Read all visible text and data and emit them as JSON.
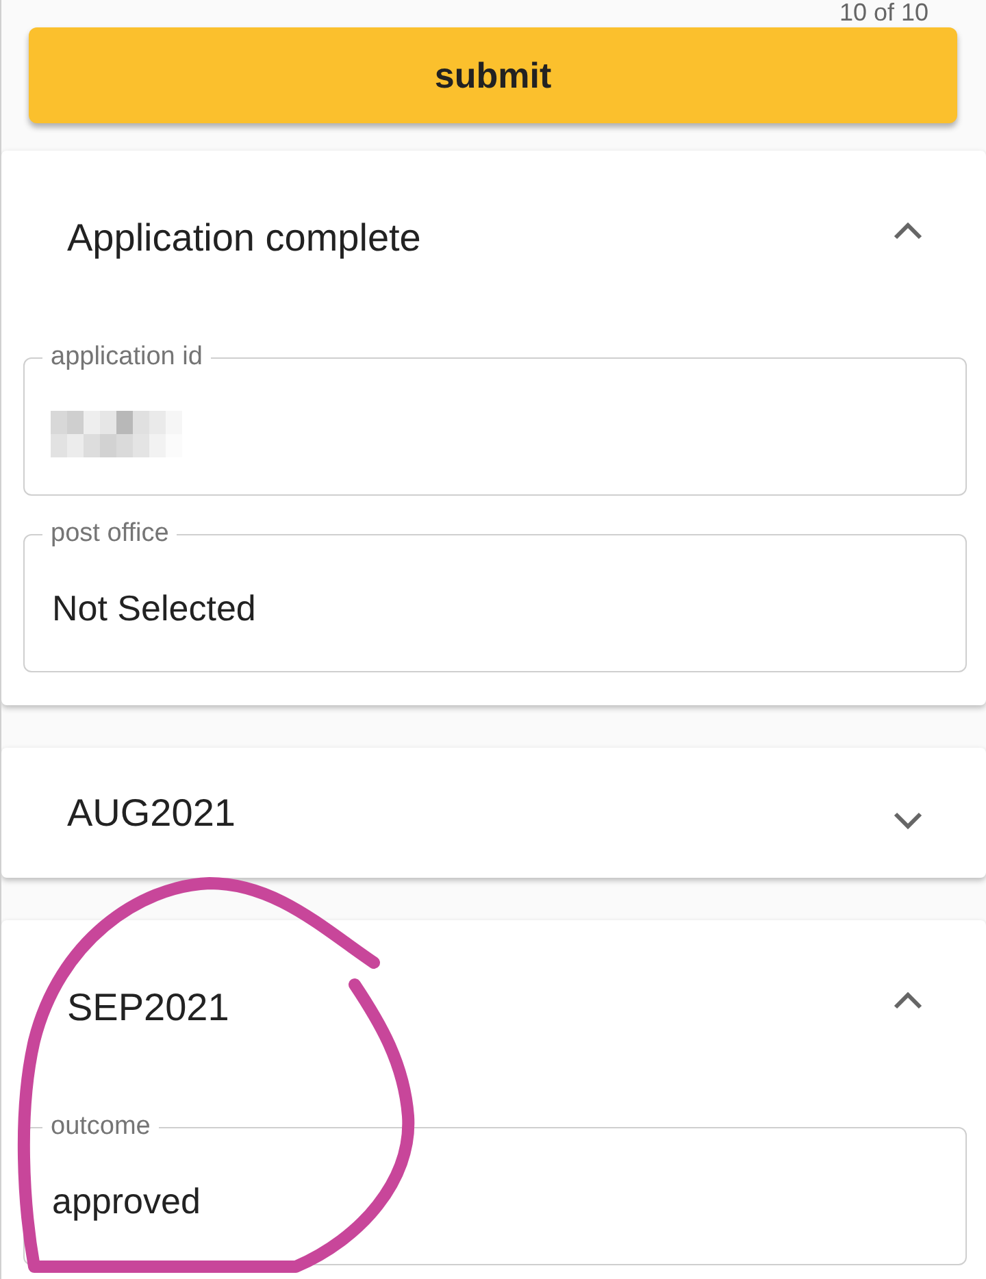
{
  "pager": {
    "text": "10 of 10"
  },
  "submit_button": {
    "label": "submit"
  },
  "panels": [
    {
      "title": "Application complete",
      "expanded": true,
      "fields": [
        {
          "label": "application id",
          "redacted": true
        },
        {
          "label": "post office",
          "value": "Not Selected",
          "redacted": false
        }
      ]
    },
    {
      "title": "AUG2021",
      "expanded": false
    },
    {
      "title": "SEP2021",
      "expanded": true,
      "fields": [
        {
          "label": "outcome",
          "value": "approved",
          "redacted": false
        }
      ]
    }
  ],
  "annotations": [
    {
      "kind": "freehand-circle"
    }
  ]
}
